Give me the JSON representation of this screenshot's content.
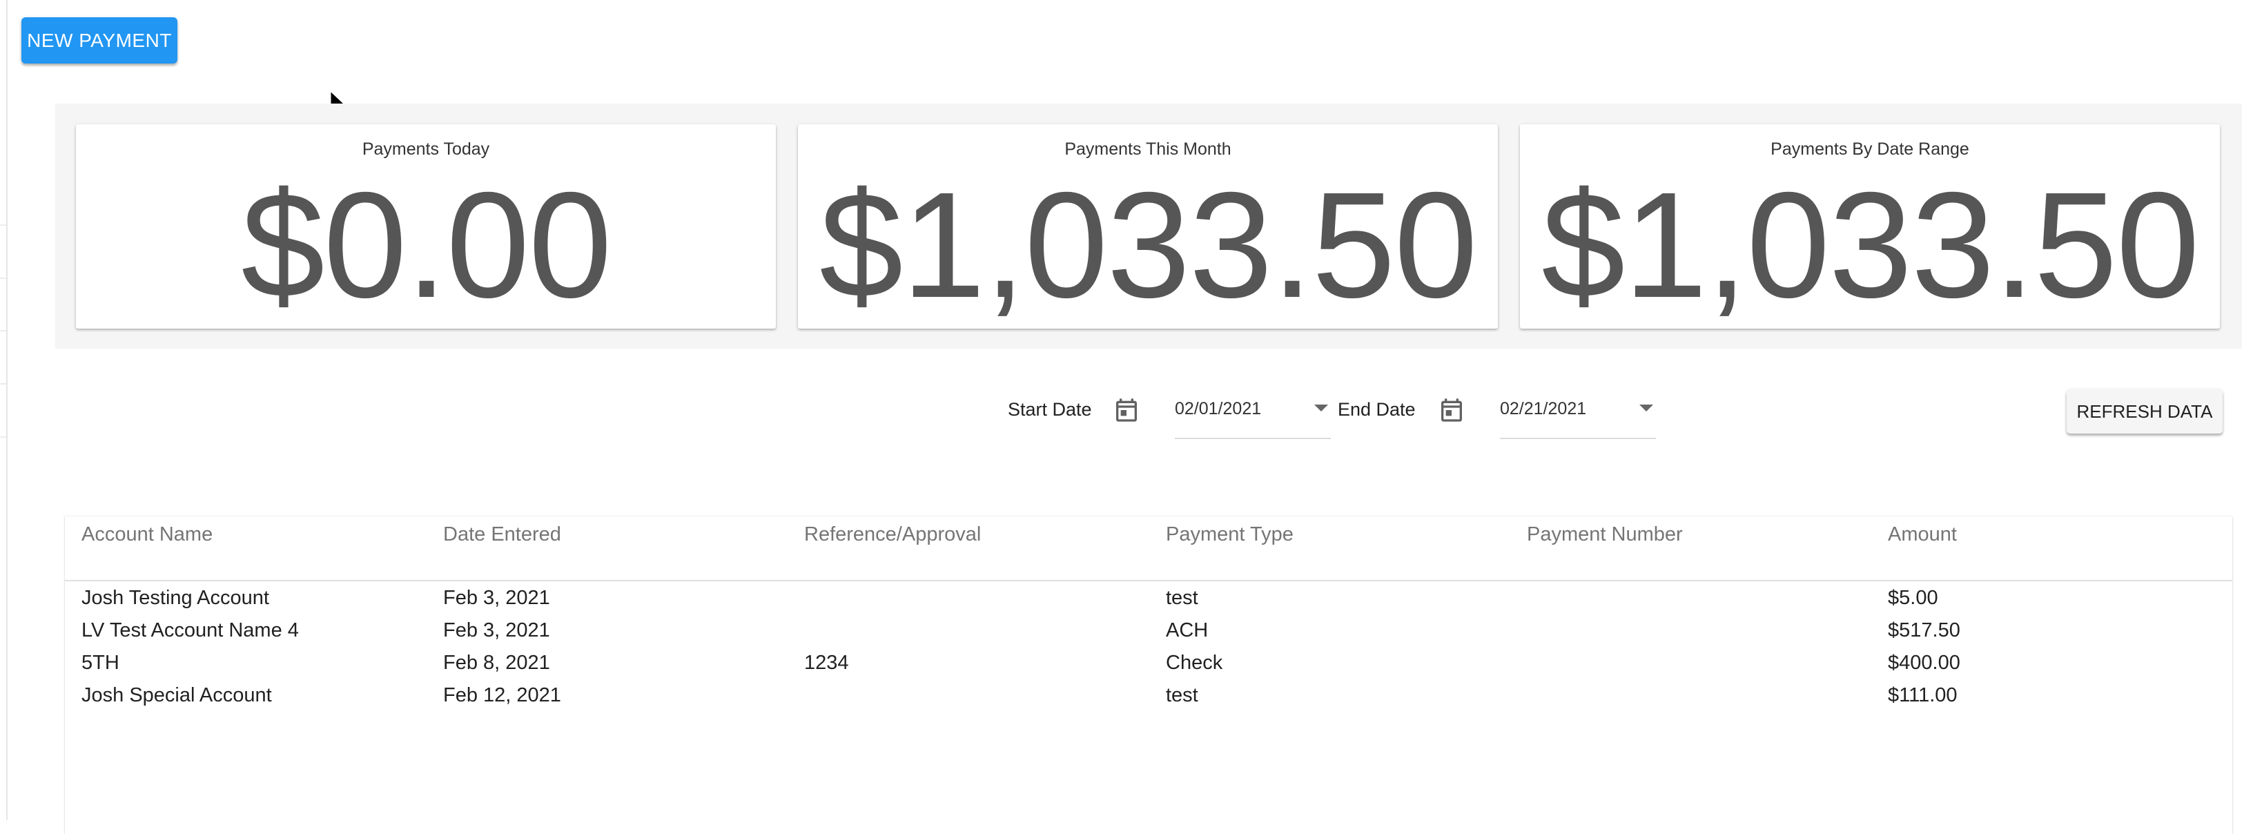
{
  "toolbar": {
    "new_payment_label": "NEW PAYMENT"
  },
  "summary": {
    "cards": [
      {
        "title": "Payments Today",
        "value": "$0.00"
      },
      {
        "title": "Payments This Month",
        "value": "$1,033.50"
      },
      {
        "title": "Payments By Date Range",
        "value": "$1,033.50"
      }
    ]
  },
  "filters": {
    "start_label": "Start Date",
    "start_value": "02/01/2021",
    "end_label": "End Date",
    "end_value": "02/21/2021",
    "refresh_label": "REFRESH DATA",
    "icons": [
      "calendar-icon",
      "chevron-down-icon"
    ]
  },
  "table": {
    "columns": [
      "Account Name",
      "Date Entered",
      "Reference/Approval",
      "Payment Type",
      "Payment Number",
      "Amount"
    ],
    "rows": [
      [
        "Josh Testing Account",
        "Feb 3, 2021",
        "",
        "test",
        "",
        "$5.00"
      ],
      [
        "LV Test Account Name 4",
        "Feb 3, 2021",
        "",
        "ACH",
        "",
        "$517.50"
      ],
      [
        "5TH",
        "Feb 8, 2021",
        "1234",
        "Check",
        "",
        "$400.00"
      ],
      [
        "Josh Special Account",
        "Feb 12, 2021",
        "",
        "test",
        "",
        "$111.00"
      ]
    ]
  },
  "colors": {
    "primary": "#2196f3",
    "value_text": "#565656",
    "panel_bg": "#f5f5f5",
    "header_text": "#757575"
  }
}
